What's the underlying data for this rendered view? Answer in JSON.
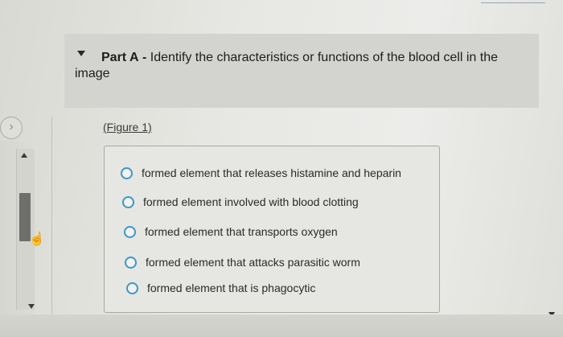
{
  "question": {
    "part_label": "Part A",
    "separator": "-",
    "prompt": "Identify the characteristics or functions of the blood cell in the image",
    "figure_link": "(Figure 1)"
  },
  "options": [
    {
      "label": "formed element that releases histamine and heparin"
    },
    {
      "label": "formed element involved with blood clotting"
    },
    {
      "label": "formed element that transports oxygen"
    },
    {
      "label": "formed element that attacks parasitic worm"
    },
    {
      "label": "formed element that is phagocytic"
    }
  ],
  "icons": {
    "toggle": "caret-down-icon",
    "nav_left": "chevron-left-icon",
    "cursor": "hand-pointer-icon"
  },
  "colors": {
    "radio_border": "#3c97c9",
    "header_band": "#d3d3cf"
  }
}
